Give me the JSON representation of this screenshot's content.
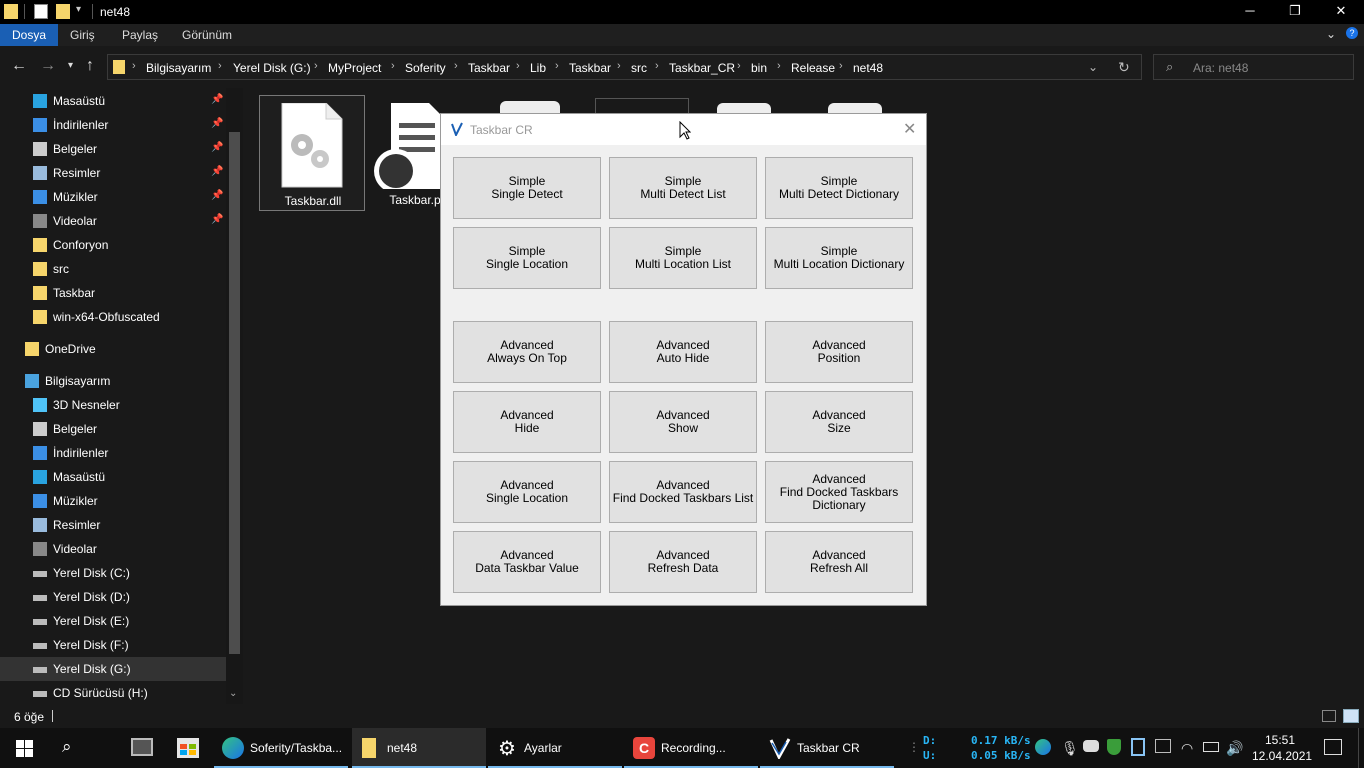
{
  "window": {
    "title": "net48",
    "controls": {
      "minimize": "─",
      "maximize": "❐",
      "close": "✕"
    }
  },
  "ribbon": {
    "tabs": [
      "Dosya",
      "Giriş",
      "Paylaş",
      "Görünüm"
    ]
  },
  "address": {
    "crumbs": [
      "Bilgisayarım",
      "Yerel Disk (G:)",
      "MyProject",
      "Soferity",
      "Taskbar",
      "Lib",
      "Taskbar",
      "src",
      "Taskbar_CR",
      "bin",
      "Release",
      "net48"
    ],
    "search_placeholder": "Ara: net48"
  },
  "sidebar": {
    "items": [
      {
        "label": "Masaüstü",
        "icon": "desktop-icon",
        "pinned": true
      },
      {
        "label": "İndirilenler",
        "icon": "download-icon",
        "pinned": true
      },
      {
        "label": "Belgeler",
        "icon": "document-icon",
        "pinned": true
      },
      {
        "label": "Resimler",
        "icon": "pictures-icon",
        "pinned": true
      },
      {
        "label": "Müzikler",
        "icon": "music-icon",
        "pinned": true
      },
      {
        "label": "Videolar",
        "icon": "video-icon",
        "pinned": true
      },
      {
        "label": "Conforyon",
        "icon": "folder-icon",
        "pinned": false
      },
      {
        "label": "src",
        "icon": "folder-icon",
        "pinned": false
      },
      {
        "label": "Taskbar",
        "icon": "folder-icon",
        "pinned": false
      },
      {
        "label": "win-x64-Obfuscated",
        "icon": "folder-icon",
        "pinned": false
      },
      {
        "label": "OneDrive",
        "icon": "folder-icon",
        "pinned": false
      },
      {
        "label": "Bilgisayarım",
        "icon": "computer-icon",
        "pinned": false
      },
      {
        "label": "3D Nesneler",
        "icon": "cube-icon",
        "pinned": false
      },
      {
        "label": "Belgeler",
        "icon": "document-icon",
        "pinned": false
      },
      {
        "label": "İndirilenler",
        "icon": "download-icon",
        "pinned": false
      },
      {
        "label": "Masaüstü",
        "icon": "desktop-icon",
        "pinned": false
      },
      {
        "label": "Müzikler",
        "icon": "music-icon",
        "pinned": false
      },
      {
        "label": "Resimler",
        "icon": "pictures-icon",
        "pinned": false
      },
      {
        "label": "Videolar",
        "icon": "video-icon",
        "pinned": false
      },
      {
        "label": "Yerel Disk (C:)",
        "icon": "drive-icon",
        "pinned": false
      },
      {
        "label": "Yerel Disk (D:)",
        "icon": "drive-icon",
        "pinned": false
      },
      {
        "label": "Yerel Disk (E:)",
        "icon": "drive-icon",
        "pinned": false
      },
      {
        "label": "Yerel Disk (F:)",
        "icon": "drive-icon",
        "pinned": false
      },
      {
        "label": "Yerel Disk (G:)",
        "icon": "drive-icon",
        "pinned": false,
        "selected": true
      },
      {
        "label": "CD Sürücüsü (H:)",
        "icon": "cd-drive-icon",
        "pinned": false
      }
    ]
  },
  "files": [
    {
      "name": "Taskbar.dll",
      "icon": "dll-file-icon"
    },
    {
      "name": "Taskbar.p",
      "icon": "pdb-file-icon"
    }
  ],
  "status": {
    "count": "6 öğe"
  },
  "dialog": {
    "title": "Taskbar CR",
    "buttons": [
      [
        "Simple",
        "Single Detect"
      ],
      [
        "Simple",
        "Multi Detect List"
      ],
      [
        "Simple",
        "Multi Detect Dictionary"
      ],
      [
        "Simple",
        "Single Location"
      ],
      [
        "Simple",
        "Multi Location List"
      ],
      [
        "Simple",
        "Multi Location Dictionary"
      ],
      [
        "Advanced",
        "Always On Top"
      ],
      [
        "Advanced",
        "Auto Hide"
      ],
      [
        "Advanced",
        "Position"
      ],
      [
        "Advanced",
        "Hide"
      ],
      [
        "Advanced",
        "Show"
      ],
      [
        "Advanced",
        "Size"
      ],
      [
        "Advanced",
        "Single Location"
      ],
      [
        "Advanced",
        "Find Docked Taskbars List"
      ],
      [
        "Advanced",
        "Find Docked Taskbars",
        "Dictionary"
      ],
      [
        "Advanced",
        "Data Taskbar Value"
      ],
      [
        "Advanced",
        "Refresh Data"
      ],
      [
        "Advanced",
        "Refresh All"
      ]
    ]
  },
  "taskbar": {
    "apps": [
      {
        "label": "Soferity/Taskba...",
        "icon": "edge-icon",
        "active": false
      },
      {
        "label": "net48",
        "icon": "folder-icon",
        "active": true
      },
      {
        "label": "Ayarlar",
        "icon": "settings-icon",
        "active": false
      },
      {
        "label": "Recording...",
        "icon": "recording-icon",
        "active": false
      },
      {
        "label": "Taskbar CR",
        "icon": "taskbar-cr-icon",
        "active": false
      }
    ],
    "net": {
      "d_label": "D:",
      "u_label": "U:",
      "down": "0.17 kB/s",
      "up": "0.05 kB/s"
    },
    "time": "15:51",
    "date": "12.04.2021"
  },
  "colors": {
    "accent": "#1a5fb4",
    "folder": "#f6d56b",
    "net_text": "#29b6f6",
    "taskbar_underline": "#76b9ed"
  }
}
